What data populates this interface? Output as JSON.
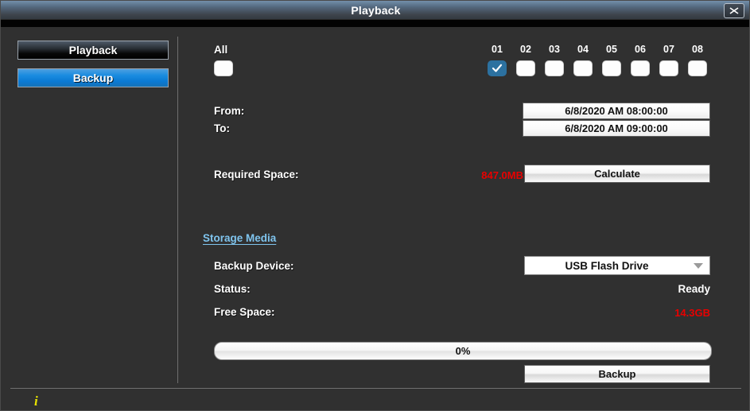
{
  "window": {
    "title": "Playback",
    "close_icon": "close-x-icon"
  },
  "sidebar": {
    "items": [
      {
        "label": "Playback",
        "active": false
      },
      {
        "label": "Backup",
        "active": true
      }
    ]
  },
  "channels": {
    "all_label": "All",
    "all_checked": false,
    "items": [
      {
        "num": "01",
        "checked": true
      },
      {
        "num": "02",
        "checked": false
      },
      {
        "num": "03",
        "checked": false
      },
      {
        "num": "04",
        "checked": false
      },
      {
        "num": "05",
        "checked": false
      },
      {
        "num": "06",
        "checked": false
      },
      {
        "num": "07",
        "checked": false
      },
      {
        "num": "08",
        "checked": false
      }
    ]
  },
  "range": {
    "from_label": "From:",
    "from_value": "6/8/2020 AM 08:00:00",
    "to_label": "To:",
    "to_value": "6/8/2020 AM 09:00:00"
  },
  "required_space": {
    "label": "Required Space:",
    "value": "847.0MB",
    "calculate_label": "Calculate"
  },
  "storage_media": {
    "header": "Storage Media",
    "backup_device_label": "Backup Device:",
    "backup_device_value": "USB Flash Drive",
    "dropdown_icon": "chevron-down-icon",
    "status_label": "Status:",
    "status_value": "Ready",
    "free_space_label": "Free Space:",
    "free_space_value": "14.3GB"
  },
  "progress": {
    "value": "0%",
    "percent": 0
  },
  "actions": {
    "backup_label": "Backup"
  },
  "statusbar": {
    "info_icon": "info-icon",
    "info_glyph": "i"
  },
  "colors": {
    "accent_blue": "#1b8ce0",
    "link_blue": "#7fc4ee",
    "alert_red": "#e80000",
    "info_yellow": "#e8e300",
    "background": "#303030"
  }
}
